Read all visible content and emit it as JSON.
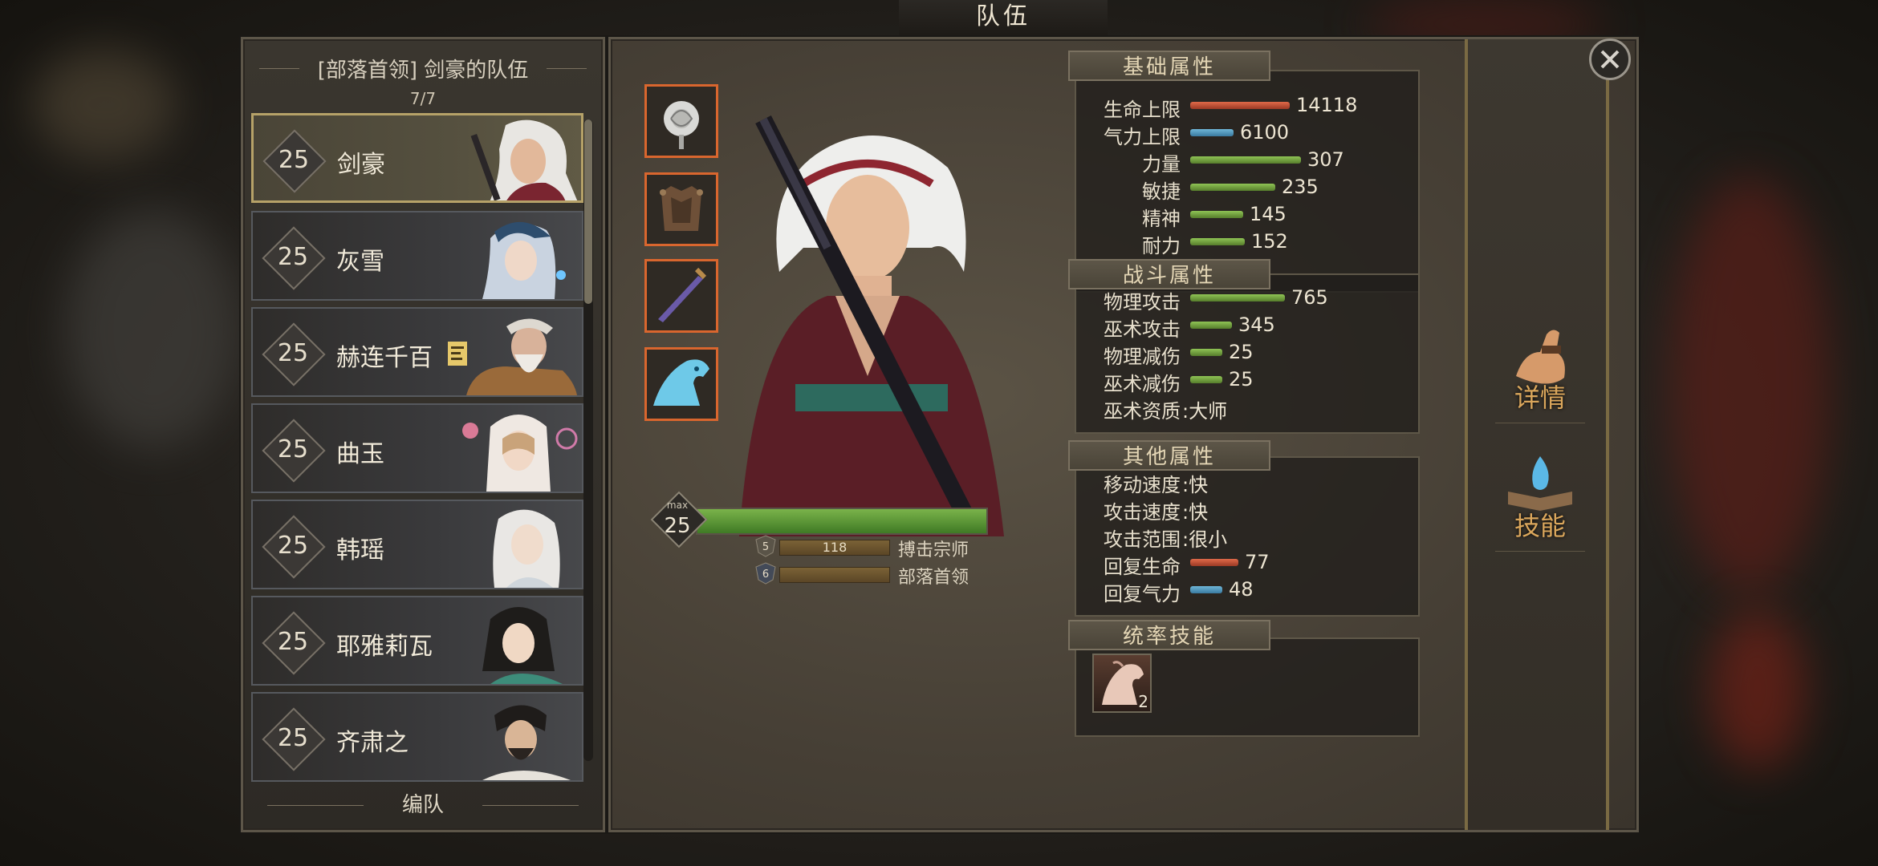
{
  "window": {
    "title": "队伍"
  },
  "roster": {
    "header": "[部落首领] 剑豪的队伍",
    "count": "7/7",
    "heroes": [
      {
        "level": "25",
        "name": "剑豪",
        "selected": true
      },
      {
        "level": "25",
        "name": "灰雪"
      },
      {
        "level": "25",
        "name": "赫连千百",
        "has_note_icon": true
      },
      {
        "level": "25",
        "name": "曲玉"
      },
      {
        "level": "25",
        "name": "韩瑶"
      },
      {
        "level": "25",
        "name": "耶雅莉瓦"
      },
      {
        "level": "25",
        "name": "齐肃之"
      }
    ],
    "formation_button": "编队"
  },
  "character": {
    "level_max_label": "max",
    "level": "25",
    "xp_progress": 1.0,
    "equipment_icons": [
      "white-rose-accessory-icon",
      "spiked-armor-icon",
      "purple-sword-icon",
      "spectral-horse-mount-icon"
    ],
    "ranks": [
      {
        "badge": "5",
        "bar_value": "118",
        "label": "搏击宗师"
      },
      {
        "badge": "6",
        "bar_value": "",
        "label": "部落首领"
      }
    ]
  },
  "attributes": {
    "basic": {
      "title": "基础属性",
      "rows": [
        {
          "label": "生命上限",
          "value": "14118",
          "bar": "red",
          "fill": 0.62
        },
        {
          "label": "气力上限",
          "value": "6100",
          "bar": "blue",
          "fill": 0.27
        },
        {
          "label": "力量",
          "value": "307",
          "bar": "green",
          "fill": 0.69
        },
        {
          "label": "敏捷",
          "value": "235",
          "bar": "green",
          "fill": 0.53
        },
        {
          "label": "精神",
          "value": "145",
          "bar": "green",
          "fill": 0.33
        },
        {
          "label": "耐力",
          "value": "152",
          "bar": "green",
          "fill": 0.34
        }
      ]
    },
    "combat": {
      "title": "战斗属性",
      "rows": [
        {
          "label": "物理攻击",
          "value": "765",
          "bar": "green",
          "fill": 0.59
        },
        {
          "label": "巫术攻击",
          "value": "345",
          "bar": "green",
          "fill": 0.26
        },
        {
          "label": "物理减伤",
          "value": "25",
          "bar": "green",
          "fill": 0.2
        },
        {
          "label": "巫术减伤",
          "value": "25",
          "bar": "green",
          "fill": 0.2
        },
        {
          "label": "巫术资质",
          "text": ":大师"
        }
      ]
    },
    "other": {
      "title": "其他属性",
      "rows": [
        {
          "label": "移动速度",
          "text": ":快"
        },
        {
          "label": "攻击速度",
          "text": ":快"
        },
        {
          "label": "攻击范围",
          "text": ":很小"
        },
        {
          "label": "回复生命",
          "value": "77",
          "bar": "red",
          "fill": 0.3
        },
        {
          "label": "回复气力",
          "value": "48",
          "bar": "blue",
          "fill": 0.2
        }
      ]
    },
    "leadership": {
      "title": "统率技能",
      "skill_icon": "horse-head-skill-icon",
      "skill_count": "2"
    }
  },
  "side_buttons": {
    "details": "详情",
    "skills": "技能"
  },
  "colors": {
    "accent_orange": "#d9662e",
    "gold": "#b6a268",
    "bar_green": "#8fc455",
    "bar_red": "#e06a49",
    "bar_blue": "#6fb6d8"
  }
}
